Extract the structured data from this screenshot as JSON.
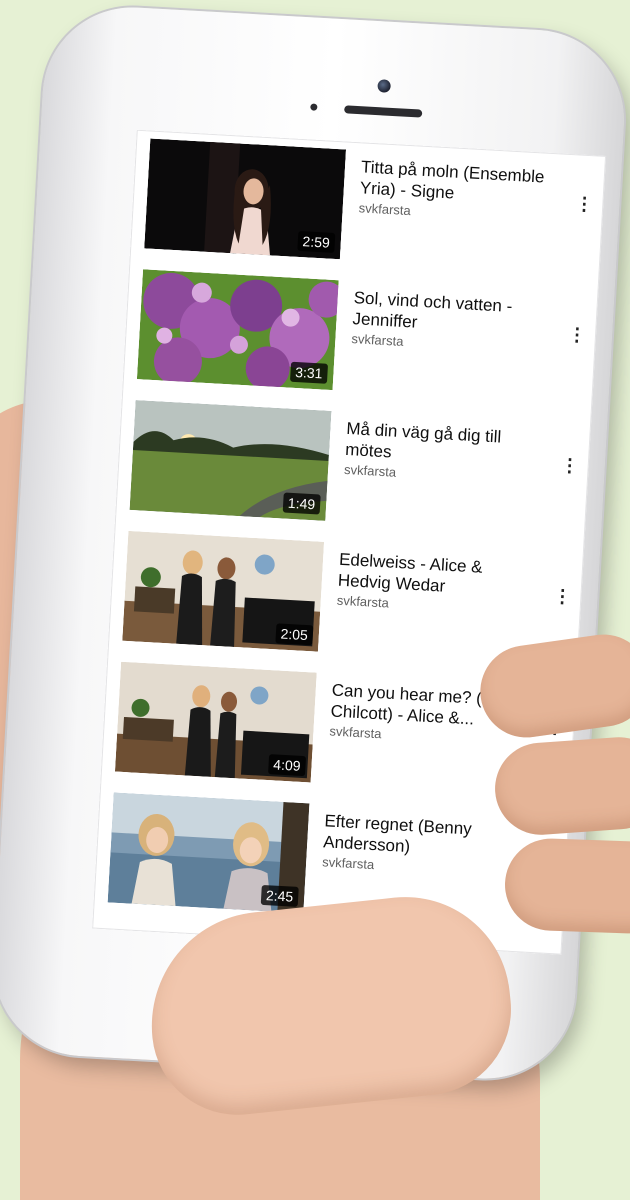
{
  "screen": {
    "videos": [
      {
        "title": "Titta på moln (Ensemble Yria) - Signe",
        "channel": "svkfarsta",
        "duration": "2:59",
        "more_icon": "more-vertical-icon"
      },
      {
        "title": "Sol, vind och vatten - Jenniffer",
        "channel": "svkfarsta",
        "duration": "3:31",
        "more_icon": "more-vertical-icon"
      },
      {
        "title": "Må din väg gå dig till mötes",
        "channel": "svkfarsta",
        "duration": "1:49",
        "more_icon": "more-vertical-icon"
      },
      {
        "title": "Edelweiss - Alice & Hedvig Wedar",
        "channel": "svkfarsta",
        "duration": "2:05",
        "more_icon": "more-vertical-icon"
      },
      {
        "title": "Can you hear me? (Bob Chilcott) - Alice &...",
        "channel": "svkfarsta",
        "duration": "4:09",
        "more_icon": "more-vertical-icon"
      },
      {
        "title": "Efter regnet (Benny Andersson)",
        "channel": "svkfarsta",
        "duration": "2:45",
        "more_icon": "more-vertical-icon"
      }
    ]
  },
  "colors": {
    "background": "#e6f1d4",
    "phone_body": "#f7f7f8",
    "title_text": "#0f0f0f",
    "channel_text": "#606060"
  }
}
